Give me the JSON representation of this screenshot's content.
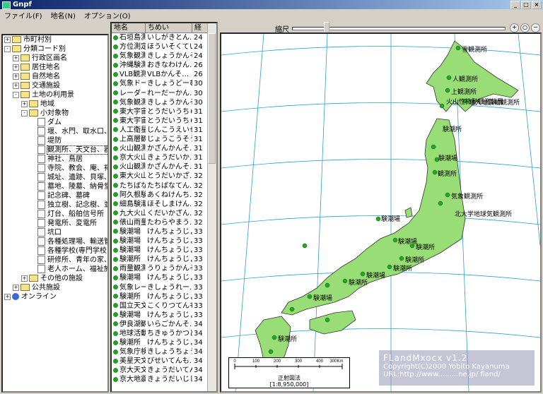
{
  "window": {
    "title": "Gnpf"
  },
  "menu": [
    "ファイル(F)",
    "地名(N)",
    "オプション(O)"
  ],
  "tree": [
    {
      "indent": 0,
      "pm": "+",
      "icon": "fold",
      "label": "市町村別"
    },
    {
      "indent": 0,
      "pm": "-",
      "icon": "fold",
      "label": "分類コード別"
    },
    {
      "indent": 1,
      "pm": "+",
      "icon": "fold",
      "label": "行政区画名"
    },
    {
      "indent": 1,
      "pm": "+",
      "icon": "fold",
      "label": "居住地名"
    },
    {
      "indent": 1,
      "pm": "+",
      "icon": "fold",
      "label": "自然地名"
    },
    {
      "indent": 1,
      "pm": "+",
      "icon": "fold",
      "label": "交通施設"
    },
    {
      "indent": 1,
      "pm": "-",
      "icon": "fold",
      "label": "土地の利用景"
    },
    {
      "indent": 2,
      "pm": "+",
      "icon": "fold",
      "label": "地域"
    },
    {
      "indent": 2,
      "pm": "-",
      "icon": "fold",
      "label": "小対象物"
    },
    {
      "indent": 3,
      "pm": "",
      "icon": "page",
      "label": "ダム"
    },
    {
      "indent": 3,
      "pm": "",
      "icon": "page",
      "label": "堰、水門、取水口、!"
    },
    {
      "indent": 3,
      "pm": "",
      "icon": "page",
      "label": "堤防"
    },
    {
      "indent": 3,
      "pm": "",
      "icon": "page",
      "label": "観測所、天文台、器",
      "sel": true
    },
    {
      "indent": 3,
      "pm": "",
      "icon": "page",
      "label": "神社、鳥居"
    },
    {
      "indent": 3,
      "pm": "",
      "icon": "page",
      "label": "寺院、教会、庵、祠、"
    },
    {
      "indent": 3,
      "pm": "",
      "icon": "page",
      "label": "城址、遺跡、貝塚、I"
    },
    {
      "indent": 3,
      "pm": "",
      "icon": "page",
      "label": "墓地、陵墓、納骨堂"
    },
    {
      "indent": 3,
      "pm": "",
      "icon": "page",
      "label": "記念碑、墓碑"
    },
    {
      "indent": 3,
      "pm": "",
      "icon": "page",
      "label": "独立樹、記念樹、並"
    },
    {
      "indent": 3,
      "pm": "",
      "icon": "page",
      "label": "灯台、船舶信号所"
    },
    {
      "indent": 3,
      "pm": "",
      "icon": "page",
      "label": "発電所、変電所"
    },
    {
      "indent": 3,
      "pm": "",
      "icon": "page",
      "label": "坑口"
    },
    {
      "indent": 3,
      "pm": "",
      "icon": "page",
      "label": "各種処理場、輸送管"
    },
    {
      "indent": 3,
      "pm": "",
      "icon": "page",
      "label": "各種学校(専門学校"
    },
    {
      "indent": 3,
      "pm": "",
      "icon": "page",
      "label": "研修所、青年の家、"
    },
    {
      "indent": 3,
      "pm": "",
      "icon": "page",
      "label": "老人ホーム、福祉施"
    },
    {
      "indent": 2,
      "pm": "+",
      "icon": "fold",
      "label": "その他の施設"
    },
    {
      "indent": 1,
      "pm": "+",
      "icon": "fold",
      "label": "公共施設"
    },
    {
      "indent": 0,
      "pm": "+",
      "icon": "globe",
      "label": "オンライン"
    }
  ],
  "list": {
    "headers": [
      "地名",
      "ちめい",
      "経"
    ],
    "rows": [
      [
        "石垣島測所",
        "いしがきとん…",
        "24"
      ],
      [
        "方位測定局",
        "ほういそくてい…",
        "24"
      ],
      [
        "気象観測所",
        "きしょうかんそ…",
        "24"
      ],
      [
        "沖縄験測場",
        "おきなわけん…",
        "26"
      ],
      [
        "VLB観測…",
        "VLBかんそ…",
        "26"
      ],
      [
        "気象ドーム",
        "きしょうどーむ",
        "30"
      ],
      [
        "レーダー観…",
        "れーだーかん…",
        "30"
      ],
      [
        "気象観測所",
        "きしょうかんそ…",
        "30"
      ],
      [
        "東大宇宙堂",
        "とうだいうちゅ…",
        "31"
      ],
      [
        "東大宇宙堂",
        "とうだいうちゅ…",
        "31"
      ],
      [
        "人工衛星観…",
        "じんこうえいせ…",
        "31"
      ],
      [
        "上高層観測…",
        "じょうこうそう…",
        "31"
      ],
      [
        "火山観測所",
        "かざんかんそ…",
        "31"
      ],
      [
        "京大火山観…",
        "きょうだいか…",
        "31"
      ],
      [
        "火山観測所",
        "かざんかんそ…",
        "31"
      ],
      [
        "東大火山観…",
        "とうだいかざ…",
        "32"
      ],
      [
        "たちばな天…",
        "たちばなてん…",
        "32"
      ],
      [
        "阿久根験…",
        "あくねけんち…",
        "32"
      ],
      [
        "細島験潮場",
        "ほそしまけん…",
        "32"
      ],
      [
        "九大火山観…",
        "くだいかざん…",
        "32"
      ],
      [
        "俵山雨量計",
        "たわらやまう…",
        "32"
      ],
      [
        "験潮場",
        "けんちょうじょ…",
        "33"
      ],
      [
        "験潮場",
        "けんちょうじょ…",
        "33"
      ],
      [
        "験潮場",
        "けんちょうじょ…",
        "33"
      ],
      [
        "験潮所",
        "けんちょうじょ…",
        "33"
      ],
      [
        "雨量観測所",
        "うりょうかんそ…",
        "33"
      ],
      [
        "験潮場",
        "けんちょうじょ…",
        "33"
      ],
      [
        "気象レーダ…",
        "きしょうれー…",
        "33"
      ],
      [
        "験潮所",
        "けんちょうじょ…",
        "33"
      ],
      [
        "国立天文台",
        "こくりつてんも…",
        "33"
      ],
      [
        "験潮場",
        "けんちょうじょ…",
        "33"
      ],
      [
        "伊良湖観測…",
        "いらごかんそ…",
        "34"
      ],
      [
        "地球活動観…",
        "ちきゅうかつど…",
        "34"
      ],
      [
        "験潮所",
        "けんちょうじょ…",
        "34"
      ],
      [
        "気象庁検潮…",
        "きしょうちょう…",
        "34"
      ],
      [
        "美星天文台",
        "びせいてんも…",
        "34"
      ],
      [
        "京大天文台",
        "きょうだいてん…",
        "34"
      ],
      [
        "京大地震観…",
        "きょうだいじし…",
        "34"
      ]
    ]
  },
  "toolbar": {
    "scale_label": "縮尺"
  },
  "map": {
    "labels": [
      "雪観測所",
      "人観測所",
      "上観測所",
      "火山性微動観測装置",
      "北大地震動観測所",
      "験潮所",
      "験潮場",
      "観測所",
      "気象観測所",
      "北大学地球気観測所",
      "験潮場",
      "験潮場",
      "験潮所",
      "験潮所",
      "験潮所",
      "験潮場",
      "験潮所",
      "験潮場",
      "験潮所"
    ],
    "scalebar": {
      "ticks": [
        "0",
        "100",
        "200",
        "300",
        "400",
        "300Km"
      ],
      "projection": "正射図法",
      "ratio": "[1:8,950,000]"
    },
    "note": {
      "title": "FLandMxocx v1.2",
      "line2": "Copyright(C)2000 Yobito Kayanuma",
      "line3": "URL:http://www.........ne.jp/ fland/"
    }
  },
  "colors": {
    "land": "#99dd77",
    "sea": "#ffffff",
    "grid": "#2aa0d8",
    "road": "#cc2222",
    "prefecture": "#444444"
  }
}
